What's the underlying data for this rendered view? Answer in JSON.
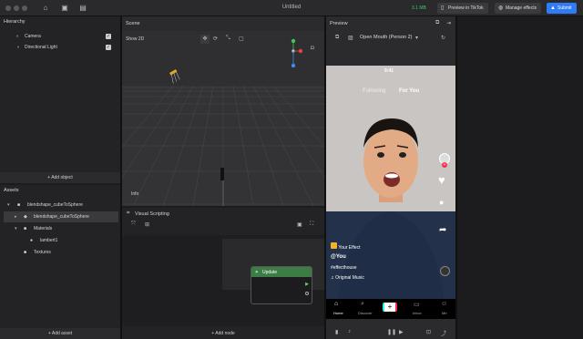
{
  "titlebar": {
    "title": "Untitled",
    "fps": "3.1 MB",
    "preview_btn": "Preview in TikTok",
    "manage_btn": "Manage effects",
    "submit_btn": "Submit"
  },
  "hierarchy": {
    "header": "Hierarchy",
    "items": [
      {
        "label": "Camera",
        "checked": true
      },
      {
        "label": "Directional Light",
        "checked": true
      }
    ],
    "add_label": "+ Add object"
  },
  "assets": {
    "header": "Assets",
    "items": [
      {
        "label": "blendshape_cubeToSphere"
      },
      {
        "label": "blendshape_cubeToSphere"
      },
      {
        "label": "Materials"
      },
      {
        "label": "lambert1"
      },
      {
        "label": "Textures"
      }
    ],
    "add_label": "+ Add asset"
  },
  "scene": {
    "header": "Scene",
    "show2d": "Show 2D",
    "info": "Info"
  },
  "visual_scripting": {
    "header": "Visual Scripting",
    "node_label": "Update",
    "add_label": "+ Add node"
  },
  "preview": {
    "header": "Preview",
    "dropdown": "Open Mouth (Person 2)",
    "time": "9:41",
    "tab_following": "Following",
    "tab_foryou": "For You",
    "effect_tag": "Your Effect",
    "username": "@You",
    "hashtag": "#effecthouse",
    "music": "Original Music",
    "nav": [
      "Home",
      "Discover",
      "",
      "Inbox",
      "Me"
    ]
  }
}
